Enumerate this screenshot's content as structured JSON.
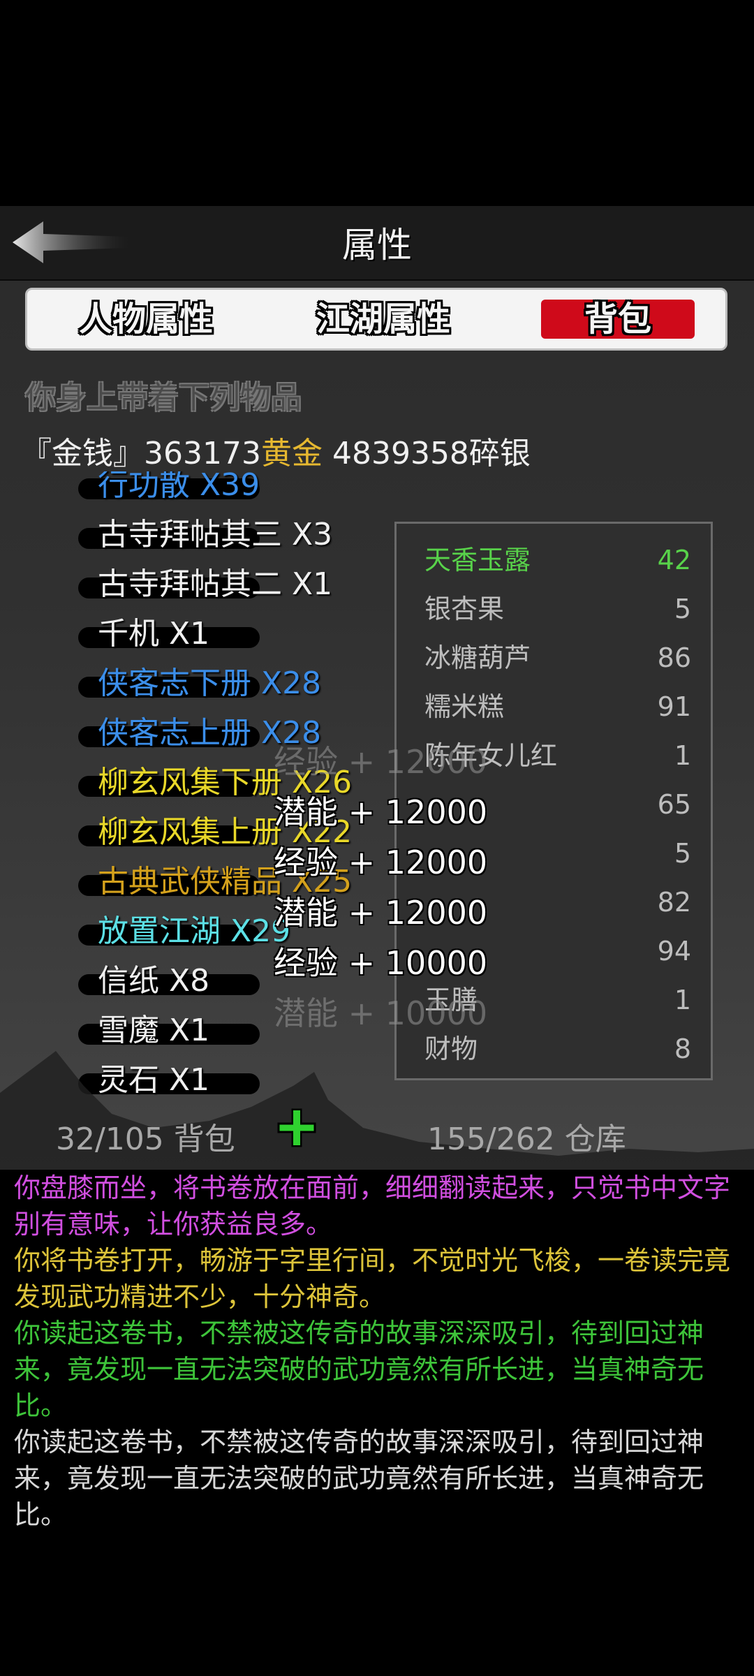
{
  "header": {
    "title": "属性"
  },
  "tabs": [
    "人物属性",
    "江湖属性",
    "背包"
  ],
  "subtitle": "你身上带着下列物品",
  "money": {
    "label": "『金钱』",
    "gold_value": "363173",
    "gold_unit": "黄金",
    "silver": "4839358碎银"
  },
  "items": [
    {
      "name": "行功散 X39",
      "color": "#3b8eea"
    },
    {
      "name": "古寺拜帖其三 X3",
      "color": "#f0f0f0"
    },
    {
      "name": "古寺拜帖其二 X1",
      "color": "#f0f0f0"
    },
    {
      "name": "千机 X1",
      "color": "#f0f0f0"
    },
    {
      "name": "侠客志下册 X28",
      "color": "#3b8eea"
    },
    {
      "name": "侠客志上册 X28",
      "color": "#3b8eea"
    },
    {
      "name": "柳玄风集下册 X26",
      "color": "#e9d829"
    },
    {
      "name": "柳玄风集上册 X22",
      "color": "#e9d829"
    },
    {
      "name": "古典武侠精品 X25",
      "color": "#d4a11c"
    },
    {
      "name": "放置江湖 X29",
      "color": "#5ce0e6"
    },
    {
      "name": "信纸 X8",
      "color": "#f0f0f0"
    },
    {
      "name": "雪魔 X1",
      "color": "#f0f0f0"
    },
    {
      "name": "灵石 X1",
      "color": "#f0f0f0"
    }
  ],
  "side_items": [
    {
      "name": "天香玉露",
      "qty": "42",
      "color": "green"
    },
    {
      "name": "银杏果",
      "qty": "5",
      "color": "dim"
    },
    {
      "name": "冰糖葫芦",
      "qty": "86",
      "color": "dim"
    },
    {
      "name": "糯米糕",
      "qty": "91",
      "color": "dim"
    },
    {
      "name": "陈年女儿红",
      "qty": "1",
      "color": "dim"
    },
    {
      "name": "",
      "qty": "65",
      "color": "dim"
    },
    {
      "name": "",
      "qty": "5",
      "color": "dim"
    },
    {
      "name": "",
      "qty": "82",
      "color": "dim"
    },
    {
      "name": "",
      "qty": "94",
      "color": "dim"
    },
    {
      "name": "玉膳",
      "qty": "1",
      "color": "dim"
    },
    {
      "name": "财物",
      "qty": "8",
      "color": "dim"
    }
  ],
  "floats": [
    {
      "text": "经验 + 12000",
      "style": "faint"
    },
    {
      "text": "潜能 + 12000",
      "style": "strong"
    },
    {
      "text": "经验 + 12000",
      "style": "strong"
    },
    {
      "text": "潜能 + 12000",
      "style": "strong"
    },
    {
      "text": "经验 + 10000",
      "style": "strong"
    },
    {
      "text": "潜能 + 10000",
      "style": "faint"
    }
  ],
  "bag_count": "32/105 背包",
  "store_count": "155/262 仓库",
  "log": [
    {
      "text": "你盘膝而坐，将书卷放在面前，细细翻读起来，只觉书中文字别有意味，让你获益良多。",
      "color": "m"
    },
    {
      "text": "你将书卷打开，畅游于字里行间，不觉时光飞梭，一卷读完竟发现武功精进不少，十分神奇。",
      "color": "y"
    },
    {
      "text": "你读起这卷书，不禁被这传奇的故事深深吸引，待到回过神来，竟发现一直无法突破的武功竟然有所长进，当真神奇无比。",
      "color": "g"
    },
    {
      "text": "你读起这卷书，不禁被这传奇的故事深深吸引，待到回过神来，竟发现一直无法突破的武功竟然有所长进，当真神奇无比。",
      "color": "w"
    }
  ]
}
